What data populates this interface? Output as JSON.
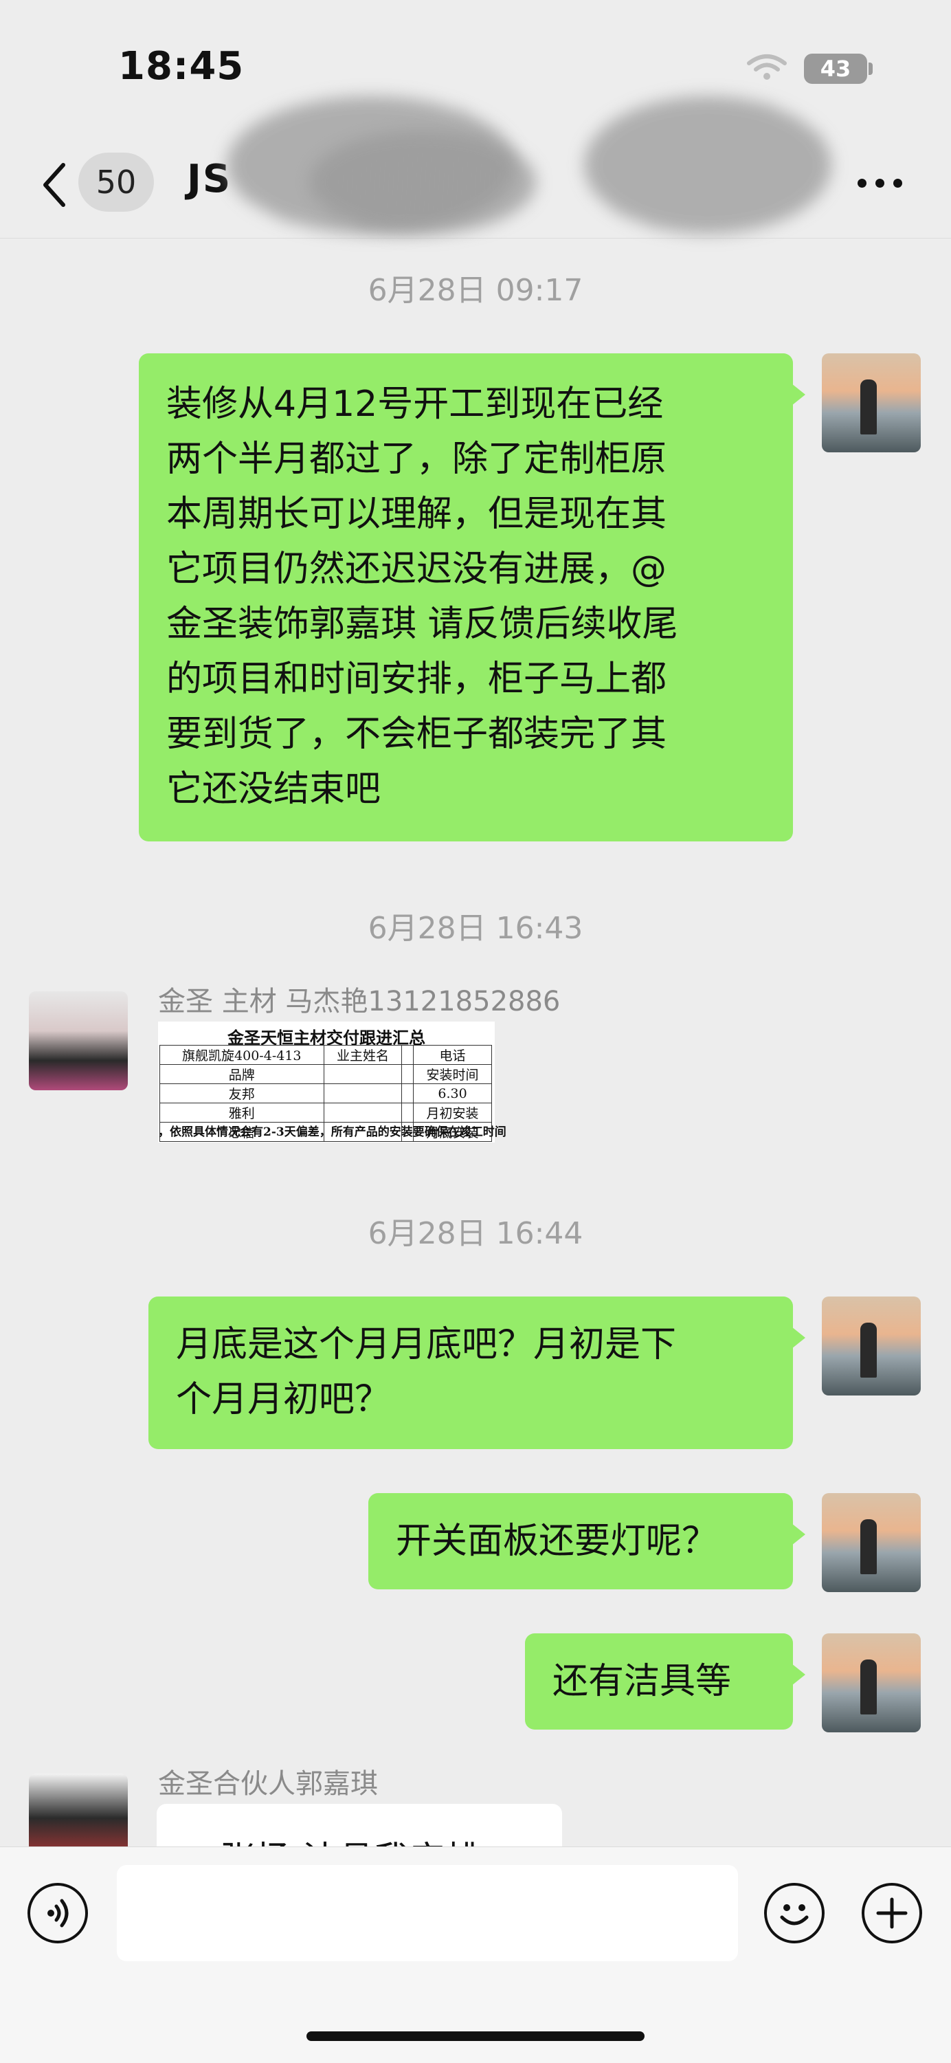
{
  "status_bar": {
    "time": "18:45",
    "battery": "43"
  },
  "header": {
    "unread_count": "50",
    "title": "JS"
  },
  "messages": [
    {
      "timestamp": "6月28日 09:17"
    },
    {
      "from": "me",
      "lines": [
        "装修从4月12号开工到现在已经",
        "两个半月都过了，除了定制柜原",
        "本周期长可以理解，但是现在其",
        "它项目仍然还迟迟没有进展，@",
        "金圣装饰郭嘉琪 请反馈后续收尾",
        "的项目和时间安排，柜子马上都",
        "要到货了，不会柜子都装完了其",
        "它还没结束吧"
      ]
    },
    {
      "timestamp": "6月28日 16:43"
    },
    {
      "from": "other",
      "sender": "金圣 主材 马杰艳13121852886",
      "image": {
        "title": "金圣天恒主材交付跟进汇总",
        "rows": [
          [
            "旗舰凯旋400-4-413",
            "业主姓名",
            "",
            "电话"
          ],
          [
            "品牌",
            "",
            "",
            "安装时间"
          ],
          [
            "友邦",
            "",
            "",
            "6.30"
          ],
          [
            "雅利",
            "",
            "",
            "月初安装"
          ],
          [
            "忠信",
            "",
            "",
            "月底安装"
          ]
        ],
        "note": "，依照具体情况会有2-3天偏差，所有产品的安装要确保在竣工时间"
      }
    },
    {
      "timestamp": "6月28日 16:44"
    },
    {
      "from": "me",
      "lines": [
        "月底是这个月月底吧？月初是下",
        "个月月初吧？"
      ]
    },
    {
      "from": "me",
      "lines": [
        "开关面板还要灯呢？"
      ]
    },
    {
      "from": "me",
      "lines": [
        "还有洁具等"
      ]
    },
    {
      "from": "other",
      "sender": "金圣合伙人郭嘉琪",
      "lines": [
        "@张扬 洁具我安排"
      ]
    }
  ]
}
